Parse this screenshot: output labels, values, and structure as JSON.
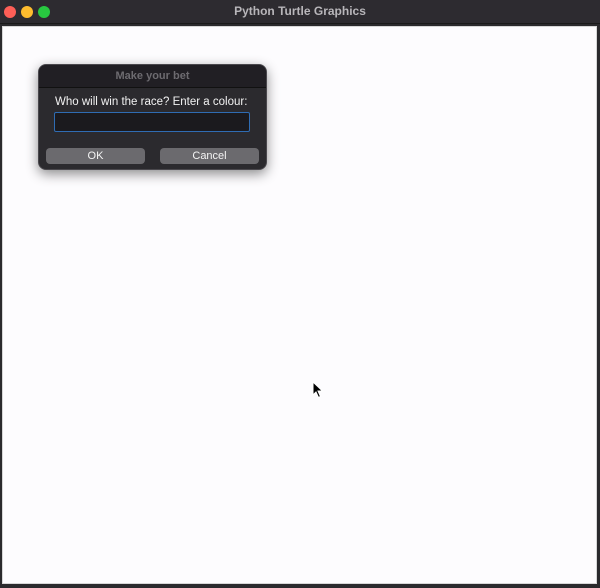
{
  "window": {
    "title": "Python Turtle Graphics"
  },
  "dialog": {
    "title": "Make your bet",
    "prompt": "Who will win the race? Enter a colour:",
    "input_value": "",
    "ok_label": "OK",
    "cancel_label": "Cancel"
  },
  "colors": {
    "close": "#fe5f57",
    "minimize": "#febc2e",
    "maximize": "#28c840",
    "canvas_background": "#fdfcfe",
    "input_focus_border": "#2f6cb3"
  },
  "icons": {
    "cursor": "mouse-pointer-icon"
  }
}
